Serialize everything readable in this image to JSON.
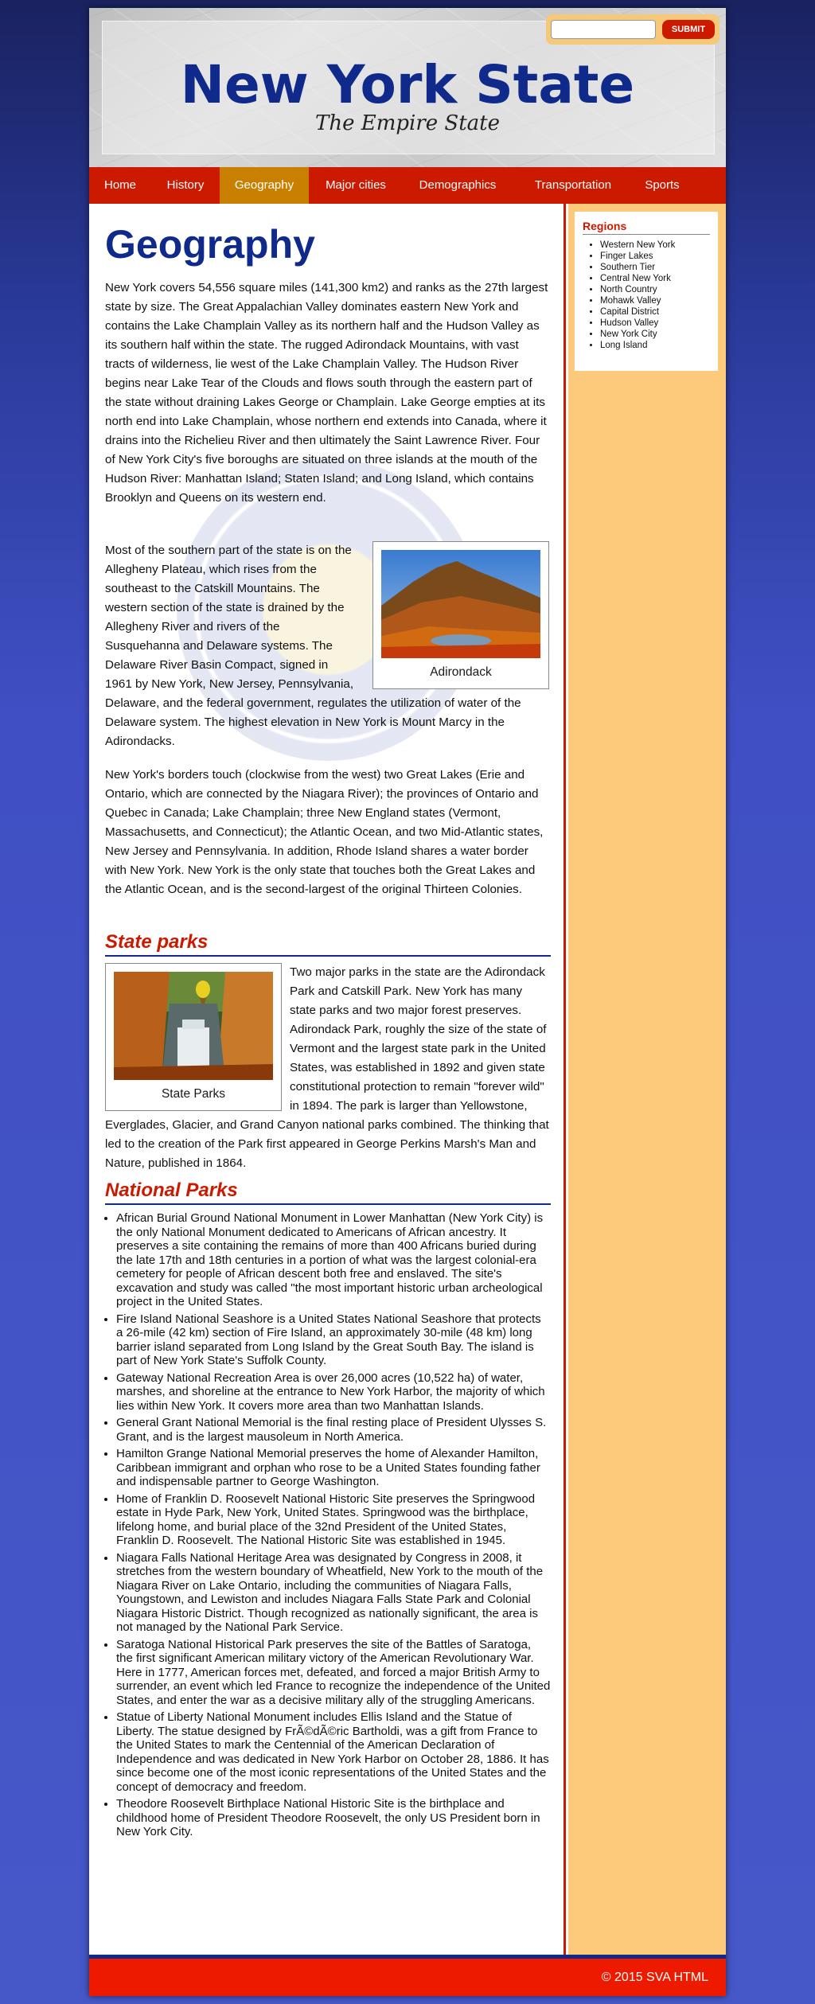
{
  "header": {
    "title": "New York State",
    "tagline": "The Empire State",
    "search": {
      "placeholder": "",
      "button_label": "SUBMIT"
    }
  },
  "nav": [
    {
      "label": "Home"
    },
    {
      "label": "History"
    },
    {
      "label": "Geography"
    },
    {
      "label": "Major cities"
    },
    {
      "label": "Demographics"
    },
    {
      "label": "Transportation"
    },
    {
      "label": "Sports"
    }
  ],
  "nav_active": "Geography",
  "colors": {
    "nav": "#cc1a00",
    "active": "#c98000",
    "title": "#0f2a8a",
    "sidebar": "#fdc97a"
  },
  "sidebar": {
    "title": "Regions",
    "items": [
      "Western New York",
      "Finger Lakes",
      "Southern Tier",
      "Central New York",
      "North Country",
      "Mohawk Valley",
      "Capital District",
      "Hudson Valley",
      "New York City",
      "Long Island"
    ]
  },
  "main": {
    "heading": "Geography",
    "p1": "New York covers 54,556 square miles (141,300 km2) and ranks as the 27th largest state by size. The Great Appalachian Valley dominates eastern New York and contains the Lake Champlain Valley as its northern half and the Hudson Valley as its southern half within the state. The rugged Adirondack Mountains, with vast tracts of wilderness, lie west of the Lake Champlain Valley. The Hudson River begins near Lake Tear of the Clouds and flows south through the eastern part of the state without draining Lakes George or Champlain. Lake George empties at its north end into Lake Champlain, whose northern end extends into Canada, where it drains into the Richelieu River and then ultimately the Saint Lawrence River. Four of New York City's five boroughs are situated on three islands at the mouth of the Hudson River: Manhattan Island; Staten Island; and Long Island, which contains Brooklyn and Queens on its western end.",
    "p2": "Most of the southern part of the state is on the Allegheny Plateau, which rises from the southeast to the Catskill Mountains. The western section of the state is drained by the Allegheny River and rivers of the Susquehanna and Delaware systems. The Delaware River Basin Compact, signed in 1961 by New York, New Jersey, Pennsylvania, Delaware, and the federal government, regulates the utilization of water of the Delaware system. The highest elevation in New York is Mount Marcy in the Adirondacks.",
    "figure1_caption": "Adirondack",
    "p3": "New York's borders touch (clockwise from the west) two Great Lakes (Erie and Ontario, which are connected by the Niagara River); the provinces of Ontario and Quebec in Canada; Lake Champlain; three New England states (Vermont, Massachusetts, and Connecticut); the Atlantic Ocean, and two Mid-Atlantic states, New Jersey and Pennsylvania. In addition, Rhode Island shares a water border with New York. New York is the only state that touches both the Great Lakes and the Atlantic Ocean, and is the second-largest of the original Thirteen Colonies.",
    "state_parks_title": "State parks",
    "figure2_caption": "State Parks",
    "p4": "Two major parks in the state are the Adirondack Park and Catskill Park. New York has many state parks and two major forest preserves. Adirondack Park, roughly the size of the state of Vermont and the largest state park in the United States, was established in 1892 and given state constitutional protection to remain \"forever wild\" in 1894. The park is larger than Yellowstone, Everglades, Glacier, and Grand Canyon national parks combined. The thinking that led to the creation of the Park first appeared in George Perkins Marsh's Man and Nature, published in 1864.",
    "national_parks_title": "National Parks",
    "national_parks": [
      "African Burial Ground National Monument in Lower Manhattan (New York City) is the only National Monument dedicated to Americans of African ancestry. It preserves a site containing the remains of more than 400 Africans buried during the late 17th and 18th centuries in a portion of what was the largest colonial-era cemetery for people of African descent both free and enslaved. The site's excavation and study was called \"the most important historic urban archeological project in the United States.",
      "Fire Island National Seashore is a United States National Seashore that protects a 26-mile (42 km) section of Fire Island, an approximately 30-mile (48 km) long barrier island separated from Long Island by the Great South Bay. The island is part of New York State's Suffolk County.",
      "Gateway National Recreation Area is over 26,000 acres (10,522 ha) of water, marshes, and shoreline at the entrance to New York Harbor, the majority of which lies within New York. It covers more area than two Manhattan Islands.",
      "General Grant National Memorial is the final resting place of President Ulysses S. Grant, and is the largest mausoleum in North America.",
      "Hamilton Grange National Memorial preserves the home of Alexander Hamilton, Caribbean immigrant and orphan who rose to be a United States founding father and indispensable partner to George Washington.",
      "Home of Franklin D. Roosevelt National Historic Site preserves the Springwood estate in Hyde Park, New York, United States. Springwood was the birthplace, lifelong home, and burial place of the 32nd President of the United States, Franklin D. Roosevelt. The National Historic Site was established in 1945.",
      "Niagara Falls National Heritage Area was designated by Congress in 2008, it stretches from the western boundary of Wheatfield, New York to the mouth of the Niagara River on Lake Ontario, including the communities of Niagara Falls, Youngstown, and Lewiston and includes Niagara Falls State Park and Colonial Niagara Historic District. Though recognized as nationally significant, the area is not managed by the National Park Service.",
      "Saratoga National Historical Park preserves the site of the Battles of Saratoga, the first significant American military victory of the American Revolutionary War. Here in 1777, American forces met, defeated, and forced a major British Army to surrender, an event which led France to recognize the independence of the United States, and enter the war as a decisive military ally of the struggling Americans.",
      "Statue of Liberty National Monument includes Ellis Island and the Statue of Liberty. The statue designed by FrÃ©dÃ©ric Bartholdi, was a gift from France to the United States to mark the Centennial of the American Declaration of Independence and was dedicated in New York Harbor on October 28, 1886. It has since become one of the most iconic representations of the United States and the concept of democracy and freedom.",
      "Theodore Roosevelt Birthplace National Historic Site is the birthplace and childhood home of President Theodore Roosevelt, the only US President born in New York City."
    ]
  },
  "footer": {
    "text": "© 2015 SVA HTML"
  }
}
